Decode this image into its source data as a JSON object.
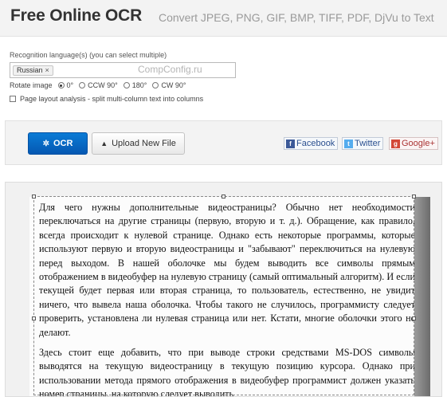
{
  "header": {
    "title": "Free Online OCR",
    "tagline": "Convert JPEG, PNG, GIF, BMP, TIFF, PDF, DjVu to Text"
  },
  "options": {
    "language_label": "Recognition language(s) (you can select multiple)",
    "selected_language": "Russian",
    "remove_symbol": "×",
    "watermark": "CompConfig.ru",
    "rotate_label": "Rotate image",
    "rotate_options": [
      "0°",
      "CCW 90°",
      "180°",
      "CW 90°"
    ],
    "rotate_selected": "0°",
    "layout_label": "Page layout analysis - split multi-column text into columns",
    "layout_checked": false
  },
  "toolbar": {
    "ocr_label": "OCR",
    "upload_label": "Upload New File",
    "share": {
      "facebook": "Facebook",
      "twitter": "Twitter",
      "google": "Google+"
    }
  },
  "preview": {
    "paragraphs": [
      "Для чего нужны дополнительные видеостраницы? Обычно нет необходимости переключаться на другие страницы (первую, вторую и т. д.). Обращение, как правило, всегда происходит к нулевой странице. Однако есть некоторые программы, которые используют первую и вторую видеостраницы и \"забывают\" переключиться на нулевую перед выходом. В нашей оболочке мы будем выводить все символы прямым отображением в видеобуфер на нулевую страницу (самый оптимальный алгоритм). И если текущей будет первая или вторая страница, то пользователь, естественно, не увидит ничего, что вывела наша оболочка. Чтобы такого не случилось, программисту следует проверить, установлена ли нулевая страница или нет. Кстати, многие оболочки этого не делают.",
      "Здесь стоит еще добавить, что при выводе строки средствами MS-DOS символы выводятся на текущую видеостраницу в текущую позицию курсора. Однако при использовании метода прямого отображения в видеобуфер программист должен указать номер страницы, на которую следует выводить"
    ]
  },
  "colors": {
    "ocr_button": "#0a6cc8",
    "header_bg": "#f3f3f3",
    "facebook": "#3b5998",
    "twitter": "#55acee",
    "google": "#d34836"
  }
}
